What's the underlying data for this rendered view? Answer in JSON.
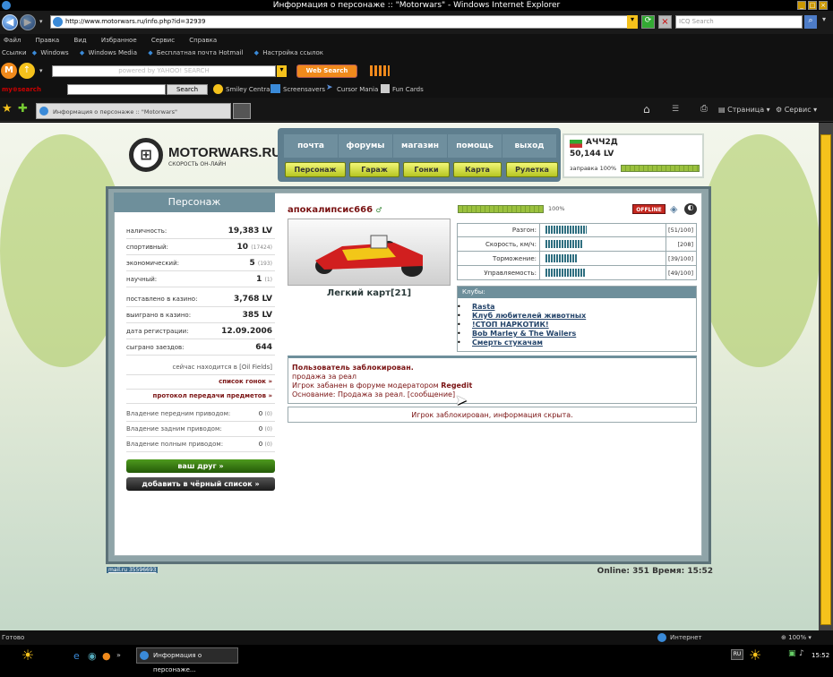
{
  "window": {
    "title": "Информация о персонаже :: \"Motorwars\" - Windows Internet Explorer"
  },
  "browser": {
    "url": "http://www.motorwars.ru/info.php?id=32939",
    "search_placeholder": "ICQ Search",
    "menu": [
      "Файл",
      "Правка",
      "Вид",
      "Избранное",
      "Сервис",
      "Справка"
    ],
    "links": [
      "Ссылки",
      "Windows",
      "Windows Media",
      "Бесплатная почта Hotmail",
      "Настройка ссылок"
    ],
    "yahoo_search_placeholder": "powered by YAHOO! SEARCH",
    "web_search_label": "Web Search",
    "myweb_search_label": "Search",
    "myweb_items": [
      "Smiley Central",
      "Screensavers",
      "Cursor Mania",
      "Fun Cards"
    ],
    "tab_title": "Информация о персонаже :: \"Motorwars\"",
    "page_menu": "Страница",
    "tools_menu": "Сервис",
    "status": "Готово",
    "zone": "Интернет",
    "zoom": "100%"
  },
  "site": {
    "logo": "MOTORWARS.RU",
    "tagline": "СКОРОСТЬ ОН-ЛАЙН",
    "nav_top": [
      "почта",
      "форумы",
      "магазин",
      "помощь",
      "выход"
    ],
    "nav_bottom": [
      "Персонаж",
      "Гараж",
      "Гонки",
      "Карта",
      "Рулетка"
    ],
    "user": {
      "name": "АЧЧ2Д",
      "money": "50,144 LV",
      "fuel": "заправка 100%"
    },
    "footer": {
      "counter": "mail.ru 35596693",
      "online": "Online: 351  Время: 15:52"
    }
  },
  "character": {
    "heading": "Персонаж",
    "stats": [
      {
        "label": "наличность:",
        "value": "19,383 LV",
        "extra": ""
      },
      {
        "label": "спортивный:",
        "value": "10",
        "extra": "(17424)"
      },
      {
        "label": "экономический:",
        "value": "5",
        "extra": "(193)"
      },
      {
        "label": "научный:",
        "value": "1",
        "extra": "(1)"
      },
      {
        "label": "поставлено в казино:",
        "value": "3,768 LV",
        "extra": ""
      },
      {
        "label": "выиграно в казино:",
        "value": "385 LV",
        "extra": ""
      },
      {
        "label": "дата регистрации:",
        "value": "12.09.2006",
        "extra": ""
      },
      {
        "label": "сыграно заездов:",
        "value": "644",
        "extra": ""
      }
    ],
    "location": "сейчас находится в [Oil Fields]",
    "races_link": "список гонок »",
    "transfers_link": "протокол передачи предметов »",
    "drives": [
      {
        "label": "Владение передним приводом:",
        "value": "0",
        "extra": "(0)"
      },
      {
        "label": "Владение задним приводом:",
        "value": "0",
        "extra": "(0)"
      },
      {
        "label": "Владение полным приводом:",
        "value": "0",
        "extra": "(0)"
      }
    ],
    "friend_button": "ваш друг »",
    "blacklist_button": "добавить в чёрный список »",
    "nickname": "апокалипсис666",
    "car_name": "Легкий карт[21]",
    "progress": "100%",
    "progress_value": 1.0,
    "status_badge": "OFFLINE",
    "car_stats": [
      {
        "label": "Разгон:",
        "value": "[51/100]",
        "level": 0.51
      },
      {
        "label": "Скорость, км/ч:",
        "value": "[208]",
        "level": 0.47
      },
      {
        "label": "Торможение:",
        "value": "[39/100]",
        "level": 0.39
      },
      {
        "label": "Управляемость:",
        "value": "[49/100]",
        "level": 0.49
      }
    ],
    "clubs_heading": "Клубы:",
    "clubs": [
      "Rasta",
      "Клуб любителей животных",
      "!СТОП НАРКОТИК!",
      "Bob Marley & The Wailers",
      "Смерть стукачам"
    ],
    "ban": {
      "title": "Пользователь заблокирован.",
      "reason_short": "продажа за реал",
      "forum_ban": "Игрок забанен в форуме модератором",
      "moderator": "Regedit",
      "basis": "Основание: Продажа за реал. [сообщение]"
    },
    "hidden_info": "Игрок заблокирован, информация скрыта."
  },
  "taskbar": {
    "task": "Информация о персонаже...",
    "lang": "RU",
    "clock": "15:52"
  }
}
